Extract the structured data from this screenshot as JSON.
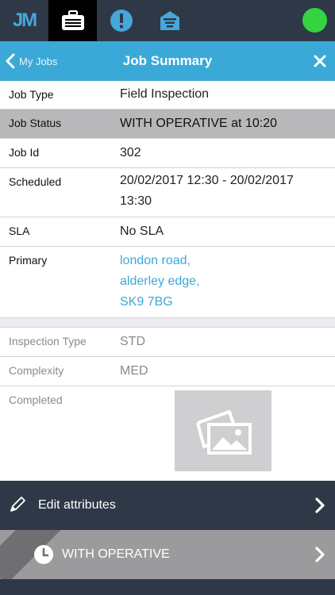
{
  "topbar": {
    "logo_text": "JM",
    "tabs": [
      {
        "icon": "briefcase-icon",
        "active": true
      },
      {
        "icon": "alert-icon",
        "active": false
      },
      {
        "icon": "inbox-icon",
        "active": false
      }
    ],
    "status_color": "#34d33f"
  },
  "nav": {
    "back_label": "My Jobs",
    "title": "Job Summary"
  },
  "details": {
    "job_type": {
      "label": "Job Type",
      "value": "Field Inspection"
    },
    "job_status": {
      "label": "Job Status",
      "value": "WITH OPERATIVE at 10:20"
    },
    "job_id": {
      "label": "Job Id",
      "value": "302"
    },
    "scheduled": {
      "label": "Scheduled",
      "value_line1": "20/02/2017 12:30 - 20/02/2017",
      "value_line2": "13:30"
    },
    "sla": {
      "label": "SLA",
      "value": "No SLA"
    },
    "primary": {
      "label": "Primary",
      "address": [
        "london road,",
        "alderley edge,",
        "SK9 7BG"
      ]
    }
  },
  "attributes": {
    "inspection_type": {
      "label": "Inspection Type",
      "value": "STD"
    },
    "complexity": {
      "label": "Complexity",
      "value": "MED"
    },
    "completed": {
      "label": "Completed",
      "image_icon": "image-placeholder-icon"
    }
  },
  "actions": {
    "edit_label": "Edit attributes",
    "status_label": "WITH OPERATIVE"
  },
  "colors": {
    "accent": "#3aa9d7",
    "dark": "#2f3846",
    "highlight_row": "#b8b8bb"
  }
}
